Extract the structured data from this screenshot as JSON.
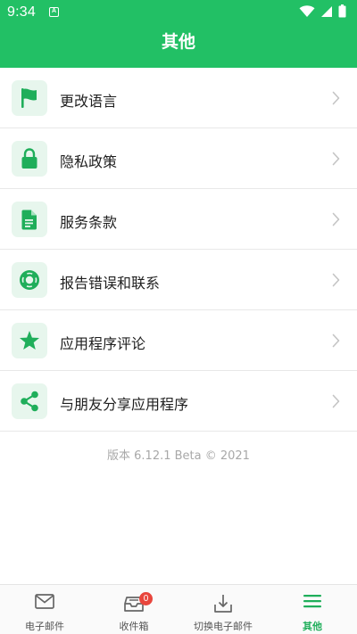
{
  "status_bar": {
    "time": "9:34",
    "notification_letter": "A",
    "icons": [
      "wifi-icon",
      "signal-icon",
      "battery-icon"
    ]
  },
  "header": {
    "title": "其他",
    "background_color": "#22c065"
  },
  "menu": {
    "items": [
      {
        "label": "更改语言",
        "icon": "flag-icon"
      },
      {
        "label": "隐私政策",
        "icon": "lock-icon"
      },
      {
        "label": "服务条款",
        "icon": "document-icon"
      },
      {
        "label": "报告错误和联系",
        "icon": "lifebuoy-icon"
      },
      {
        "label": "应用程序评论",
        "icon": "star-icon"
      },
      {
        "label": "与朋友分享应用程序",
        "icon": "share-icon"
      }
    ]
  },
  "version": "版本 6.12.1 Beta © 2021",
  "bottom_nav": {
    "items": [
      {
        "label": "电子邮件",
        "icon": "mail-icon"
      },
      {
        "label": "收件箱",
        "icon": "inbox-icon",
        "badge": "0"
      },
      {
        "label": "切换电子邮件",
        "icon": "download-tray-icon"
      },
      {
        "label": "其他",
        "icon": "menu-icon",
        "active": true
      }
    ],
    "accent_color": "#1fae5a"
  }
}
